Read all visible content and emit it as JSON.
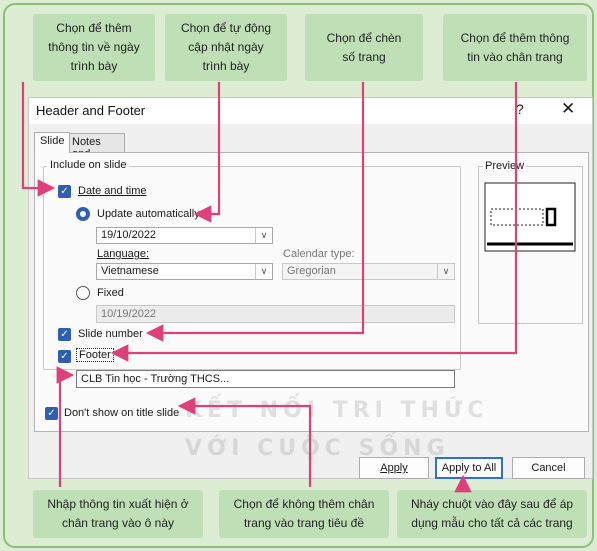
{
  "callouts": {
    "date_info": "Chọn để thêm\nthông tin về ngày\ntrình bày",
    "auto_update": "Chọn để tự động\ncập nhật ngày\ntrình bày",
    "slide_number": "Chọn để chèn\nsố trang",
    "footer_info": "Chọn để thêm thông\ntin vào chân trang",
    "footer_text": "Nhập thông tin xuất hiện ở\nchân trang vào ô này",
    "title_slide": "Chọn để không thêm chân\ntrang vào trang tiêu đề",
    "apply_all": "Nháy chuột vào đây sau để áp\ndụng mẫu cho tất cả các trang"
  },
  "dialog": {
    "title": "Header and Footer",
    "help": "?",
    "close": "✕",
    "tabs": [
      "Slide",
      "Notes and Handouts"
    ],
    "group_label": "Include on slide",
    "date_time_label": "Date and time",
    "update_auto_label": "Update automatically",
    "date_value": "19/10/2022",
    "language_label": "Language:",
    "language_value": "Vietnamese",
    "calendar_label": "Calendar type:",
    "calendar_value": "Gregorian",
    "fixed_label": "Fixed",
    "fixed_value": "10/19/2022",
    "slide_number_label": "Slide number",
    "footer_label": "Footer",
    "footer_value": "CLB Tin học - Trường THCS...",
    "dont_show_label": "Don't show on title slide",
    "preview_label": "Preview",
    "apply_label": "Apply",
    "apply_all_label": "Apply to All",
    "cancel_label": "Cancel"
  },
  "watermark": {
    "line1": "KẾT NỐI TRI THỨC",
    "line2": "VỚI CUỘC SỐNG"
  },
  "colors": {
    "background": "#dcedd4",
    "callout": "#bfe0b6",
    "arrow": "#e0407a",
    "checkbox": "#2f5fb5"
  }
}
